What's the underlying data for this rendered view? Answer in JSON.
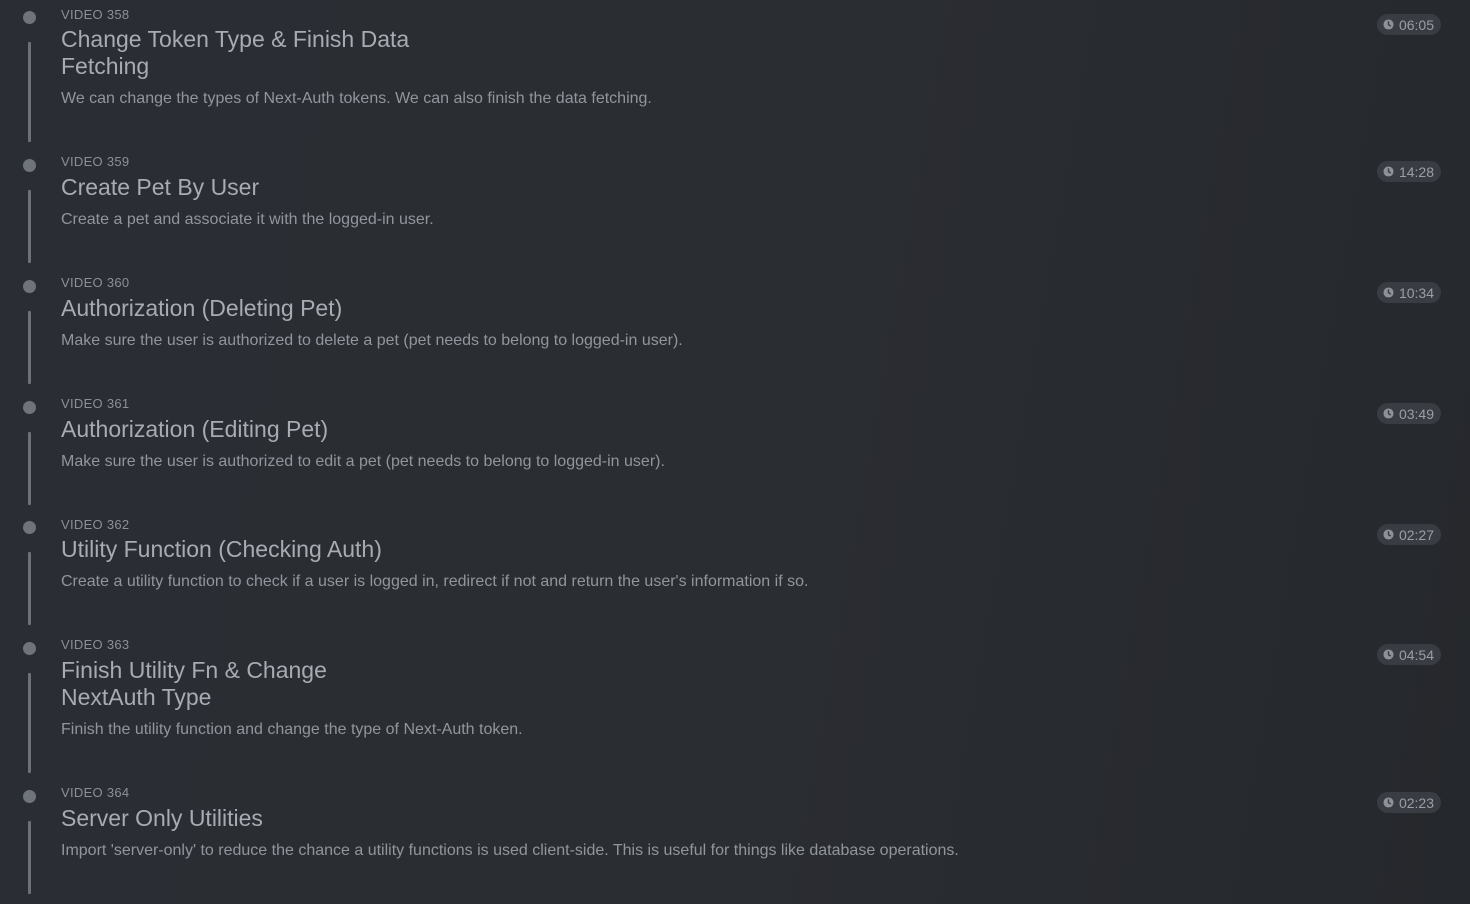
{
  "videos": [
    {
      "label": "VIDEO 358",
      "title_line1": "Change Token Type & Finish Data",
      "title_line2": "Fetching",
      "description": "We can change the types of Next-Auth tokens. We can also finish the data fetching.",
      "duration": "06:05"
    },
    {
      "label": "VIDEO 359",
      "title_line1": "Create Pet By User",
      "description": "Create a pet and associate it with the logged-in user.",
      "duration": "14:28"
    },
    {
      "label": "VIDEO 360",
      "title_line1": "Authorization (Deleting Pet)",
      "description": "Make sure the user is authorized to delete a pet (pet needs to belong to logged-in user).",
      "duration": "10:34"
    },
    {
      "label": "VIDEO 361",
      "title_line1": "Authorization (Editing Pet)",
      "description": "Make sure the user is authorized to edit a pet (pet needs to belong to logged-in user).",
      "duration": "03:49"
    },
    {
      "label": "VIDEO 362",
      "title_line1": "Utility Function (Checking Auth)",
      "description": "Create a utility function to check if a user is logged in, redirect if not and return the user's information if so.",
      "duration": "02:27"
    },
    {
      "label": "VIDEO 363",
      "title_line1": "Finish Utility Fn & Change",
      "title_line2": "NextAuth Type",
      "description": "Finish the utility function and change the type of Next-Auth token.",
      "duration": "04:54"
    },
    {
      "label": "VIDEO 364",
      "title_line1": "Server Only Utilities",
      "description": "Import 'server-only' to reduce the chance a utility functions is used client-side. This is useful for things like database operations.",
      "duration": "02:23"
    }
  ],
  "icons": {
    "duration": "clock-icon"
  },
  "colors": {
    "background": "#2a2d32",
    "timeline": "#6f737a",
    "badge": "#393c42"
  }
}
